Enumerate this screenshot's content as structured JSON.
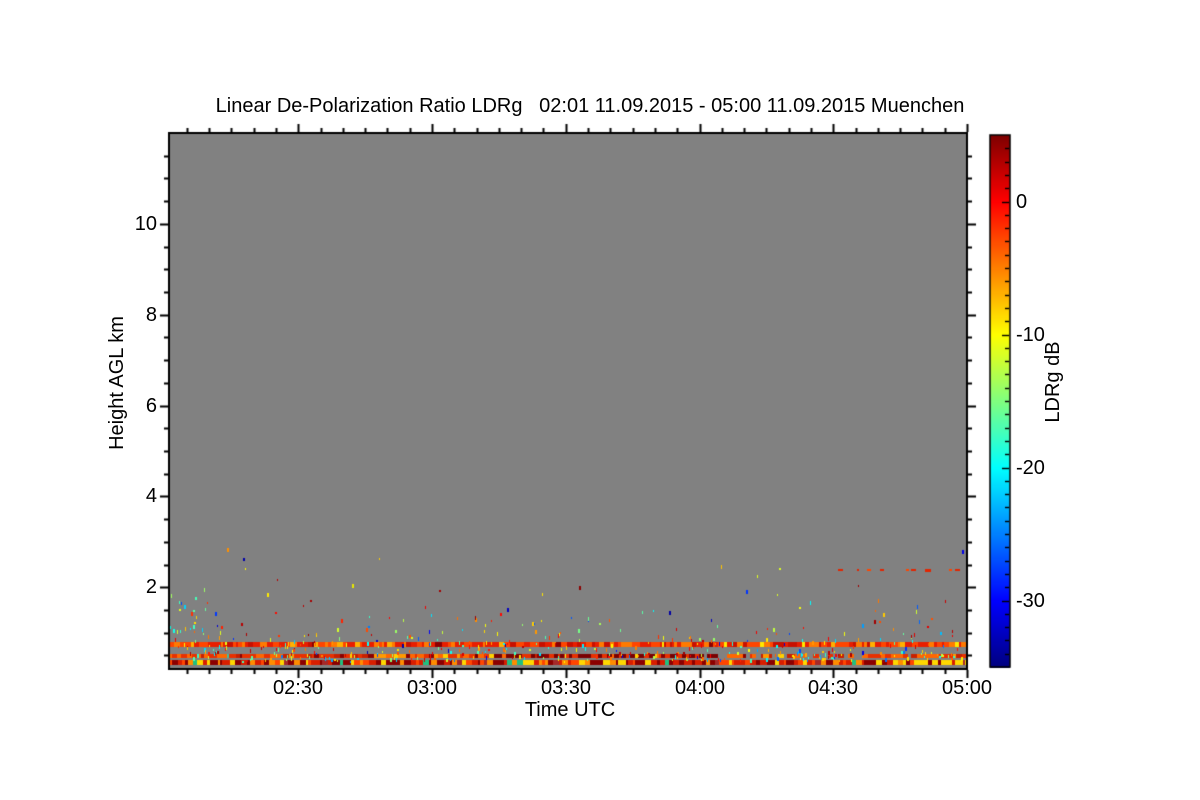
{
  "chart_data": {
    "type": "heatmap",
    "title": "Linear De-Polarization Ratio LDRg   02:01 11.09.2015 - 05:00 11.09.2015 Muenchen",
    "site": "Muenchen",
    "time_start": "02:01 11.09.2015",
    "time_end": "05:00 11.09.2015",
    "xlabel": "Time UTC",
    "ylabel": "Height AGL km",
    "plot_bg": "#818181",
    "axis_color": "#000000",
    "x_range_minutes": [
      121,
      300
    ],
    "x_minor_step_minutes": 5,
    "x_major_ticks": [
      {
        "minutes": 150,
        "label": "02:30"
      },
      {
        "minutes": 180,
        "label": "03:00"
      },
      {
        "minutes": 210,
        "label": "03:30"
      },
      {
        "minutes": 240,
        "label": "04:00"
      },
      {
        "minutes": 270,
        "label": "04:30"
      },
      {
        "minutes": 300,
        "label": "05:00"
      }
    ],
    "y_range_km": [
      0.2,
      12.0
    ],
    "y_minor_step_km": 0.5,
    "y_major_ticks": [
      {
        "km": 2,
        "label": "2"
      },
      {
        "km": 4,
        "label": "4"
      },
      {
        "km": 6,
        "label": "6"
      },
      {
        "km": 8,
        "label": "8"
      },
      {
        "km": 10,
        "label": "10"
      }
    ],
    "colorbar": {
      "label": "LDRg dB",
      "colormap": "jet",
      "min_db": -35,
      "max_db": 5,
      "minor_step_db": 1,
      "major_ticks": [
        {
          "db": 0,
          "label": "0"
        },
        {
          "db": -10,
          "label": "-10"
        },
        {
          "db": -20,
          "label": "-20"
        },
        {
          "db": -30,
          "label": "-30"
        }
      ]
    },
    "features": {
      "clutter_stripes": [
        {
          "height_km": 0.73,
          "thickness_px": 5,
          "palette": [
            [
              "#e81e00",
              38
            ],
            [
              "#ff4500",
              26
            ],
            [
              "#ff7a00",
              16
            ],
            [
              "#c81000",
              8
            ],
            [
              "#ffb000",
              5
            ],
            [
              "#ffe800",
              4
            ],
            [
              "#8b0000",
              3
            ]
          ],
          "overrides": []
        },
        {
          "height_km": 0.49,
          "thickness_px": 4,
          "palette": [
            [
              "#ff6600",
              30
            ],
            [
              "#e83000",
              35
            ],
            [
              "#c82000",
              12
            ],
            [
              "#ff9900",
              10
            ],
            [
              "#ffd000",
              5
            ],
            [
              "#8b0000",
              6
            ],
            [
              "#40c0a0",
              2
            ]
          ],
          "overrides": [
            [
              0.36,
              0.69,
              "#7a0000",
              0.45
            ],
            [
              0.66,
              0.93,
              "#818181",
              0.45
            ]
          ]
        },
        {
          "height_km": 0.34,
          "thickness_px": 5,
          "palette": [
            [
              "#8b0000",
              30
            ],
            [
              "#d81e00",
              26
            ],
            [
              "#ff4500",
              15
            ],
            [
              "#ff8c00",
              10
            ],
            [
              "#ffd700",
              11
            ],
            [
              "#a52a2a",
              5
            ],
            [
              "#20c080",
              3
            ]
          ],
          "overrides": [
            [
              0.9,
              1.0,
              "#ffd700",
              0.55
            ]
          ]
        }
      ],
      "dotted_line": {
        "height_km": 2.38,
        "start_minutes": 267,
        "end_minutes": 300,
        "colors": [
          "#e32400",
          "#ff4500"
        ]
      },
      "speckle": {
        "seed": 42,
        "count": 430,
        "base_km": 0.34,
        "scale_km": 0.4,
        "max_km": 2.85,
        "color_mix": {
          "warm": 0.62,
          "mid": 0.26,
          "cold": 0.12
        }
      },
      "left_cluster": {
        "count": 26,
        "start_minutes": 121,
        "end_minutes": 132,
        "h_min_km": 0.4,
        "h_max_km": 1.8
      },
      "notable_points": [
        {
          "minutes": 134,
          "height_km": 2.77,
          "color": "#ff9000"
        },
        {
          "minutes": 213,
          "height_km": 1.94,
          "color": "#8b0000"
        },
        {
          "minutes": 162,
          "height_km": 1.98,
          "color": "#e8e800"
        }
      ]
    }
  }
}
